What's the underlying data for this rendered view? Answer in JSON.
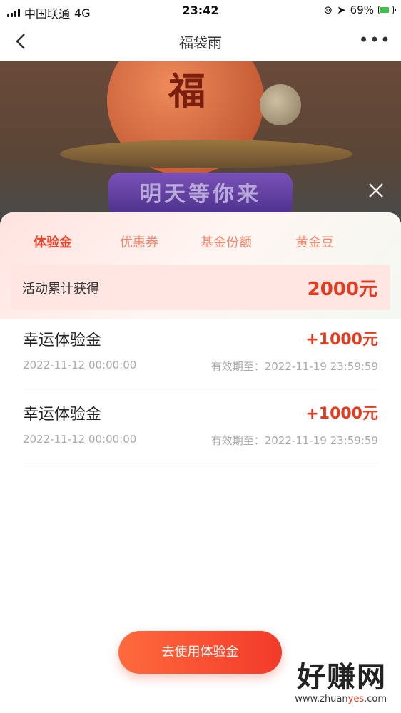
{
  "status_bar": {
    "carrier": "中国联通",
    "network": "4G",
    "time": "23:42",
    "battery": "69%"
  },
  "nav": {
    "title": "福袋雨",
    "back_icon": "chevron-left-icon",
    "more_icon": "more-horizontal-icon"
  },
  "banner": {
    "fu_char": "福",
    "button_label": "明天等你来"
  },
  "tabs": [
    {
      "label": "体验金",
      "active": true
    },
    {
      "label": "优惠券",
      "active": false
    },
    {
      "label": "基金份额",
      "active": false
    },
    {
      "label": "黄金豆",
      "active": false
    }
  ],
  "summary": {
    "label": "活动累计获得",
    "value": "2000元"
  },
  "records": [
    {
      "name": "幸运体验金",
      "amount": "+1000元",
      "date": "2022-11-12 00:00:00",
      "expire": "有效期至：2022-11-19 23:59:59"
    },
    {
      "name": "幸运体验金",
      "amount": "+1000元",
      "date": "2022-11-12 00:00:00",
      "expire": "有效期至：2022-11-19 23:59:59"
    }
  ],
  "cta": {
    "label": "去使用体验金"
  },
  "watermark": {
    "big": "好赚网",
    "small_prefix": "www.zhuan",
    "small_highlight": "yes",
    "small_suffix": ".com"
  },
  "colors": {
    "accent": "#e23b1f",
    "tab_inactive": "#f2866b",
    "summary_bg": "#ffe6e3"
  }
}
